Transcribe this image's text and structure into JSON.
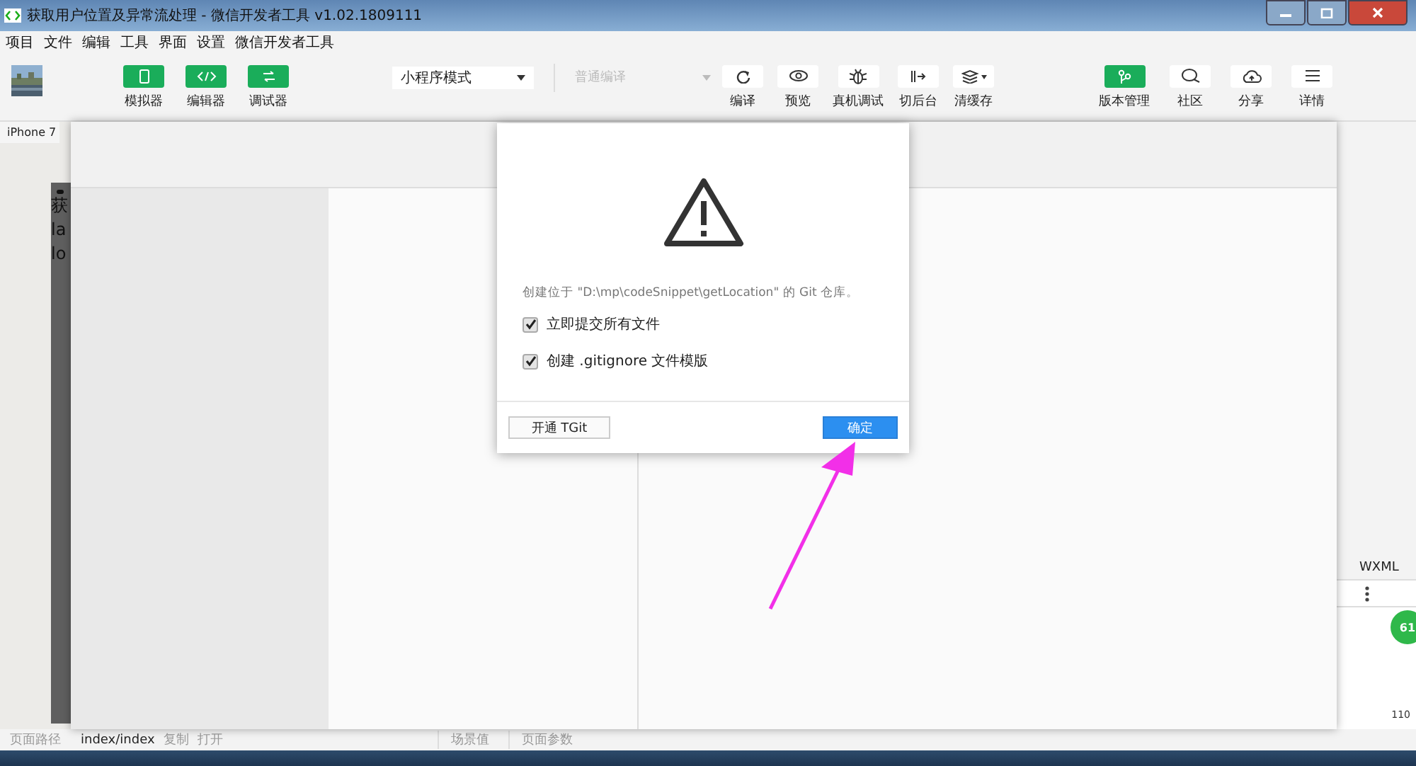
{
  "window": {
    "title": "获取用户位置及异常流处理 - 微信开发者工具 v1.02.1809111"
  },
  "menu": [
    "项目",
    "文件",
    "编辑",
    "工具",
    "界面",
    "设置",
    "微信开发者工具"
  ],
  "toolbar": {
    "views": [
      {
        "label": "模拟器"
      },
      {
        "label": "编辑器"
      },
      {
        "label": "调试器"
      }
    ],
    "mode_select": "小程序模式",
    "compile_select": {
      "placeholder": "普通编译"
    },
    "actions": [
      {
        "label": "编译"
      },
      {
        "label": "预览"
      },
      {
        "label": "真机调试"
      },
      {
        "label": "切后台"
      },
      {
        "label": "清缓存"
      }
    ],
    "right": [
      {
        "label": "版本管理",
        "primary": true
      },
      {
        "label": "社区",
        "primary": false
      },
      {
        "label": "分享",
        "primary": false
      },
      {
        "label": "详情",
        "primary": false
      }
    ]
  },
  "simulator": {
    "device": "iPhone 7",
    "lines": [
      "获",
      "la",
      "lo"
    ]
  },
  "dialog": {
    "message": "创建位于 \"D:\\mp\\codeSnippet\\getLocation\" 的 Git 仓库。",
    "options": [
      {
        "label": "立即提交所有文件",
        "checked": true
      },
      {
        "label": "创建 .gitignore 文件模版",
        "checked": true
      }
    ],
    "secondary_button": "开通 TGit",
    "primary_button": "确定"
  },
  "debugger": {
    "tab": "WXML",
    "badge": "61",
    "value": "110"
  },
  "status_bar": {
    "path_label": "页面路径",
    "path": "index/index",
    "links": [
      "复制",
      "打开"
    ],
    "tabs": [
      "场景值",
      "页面参数"
    ]
  }
}
